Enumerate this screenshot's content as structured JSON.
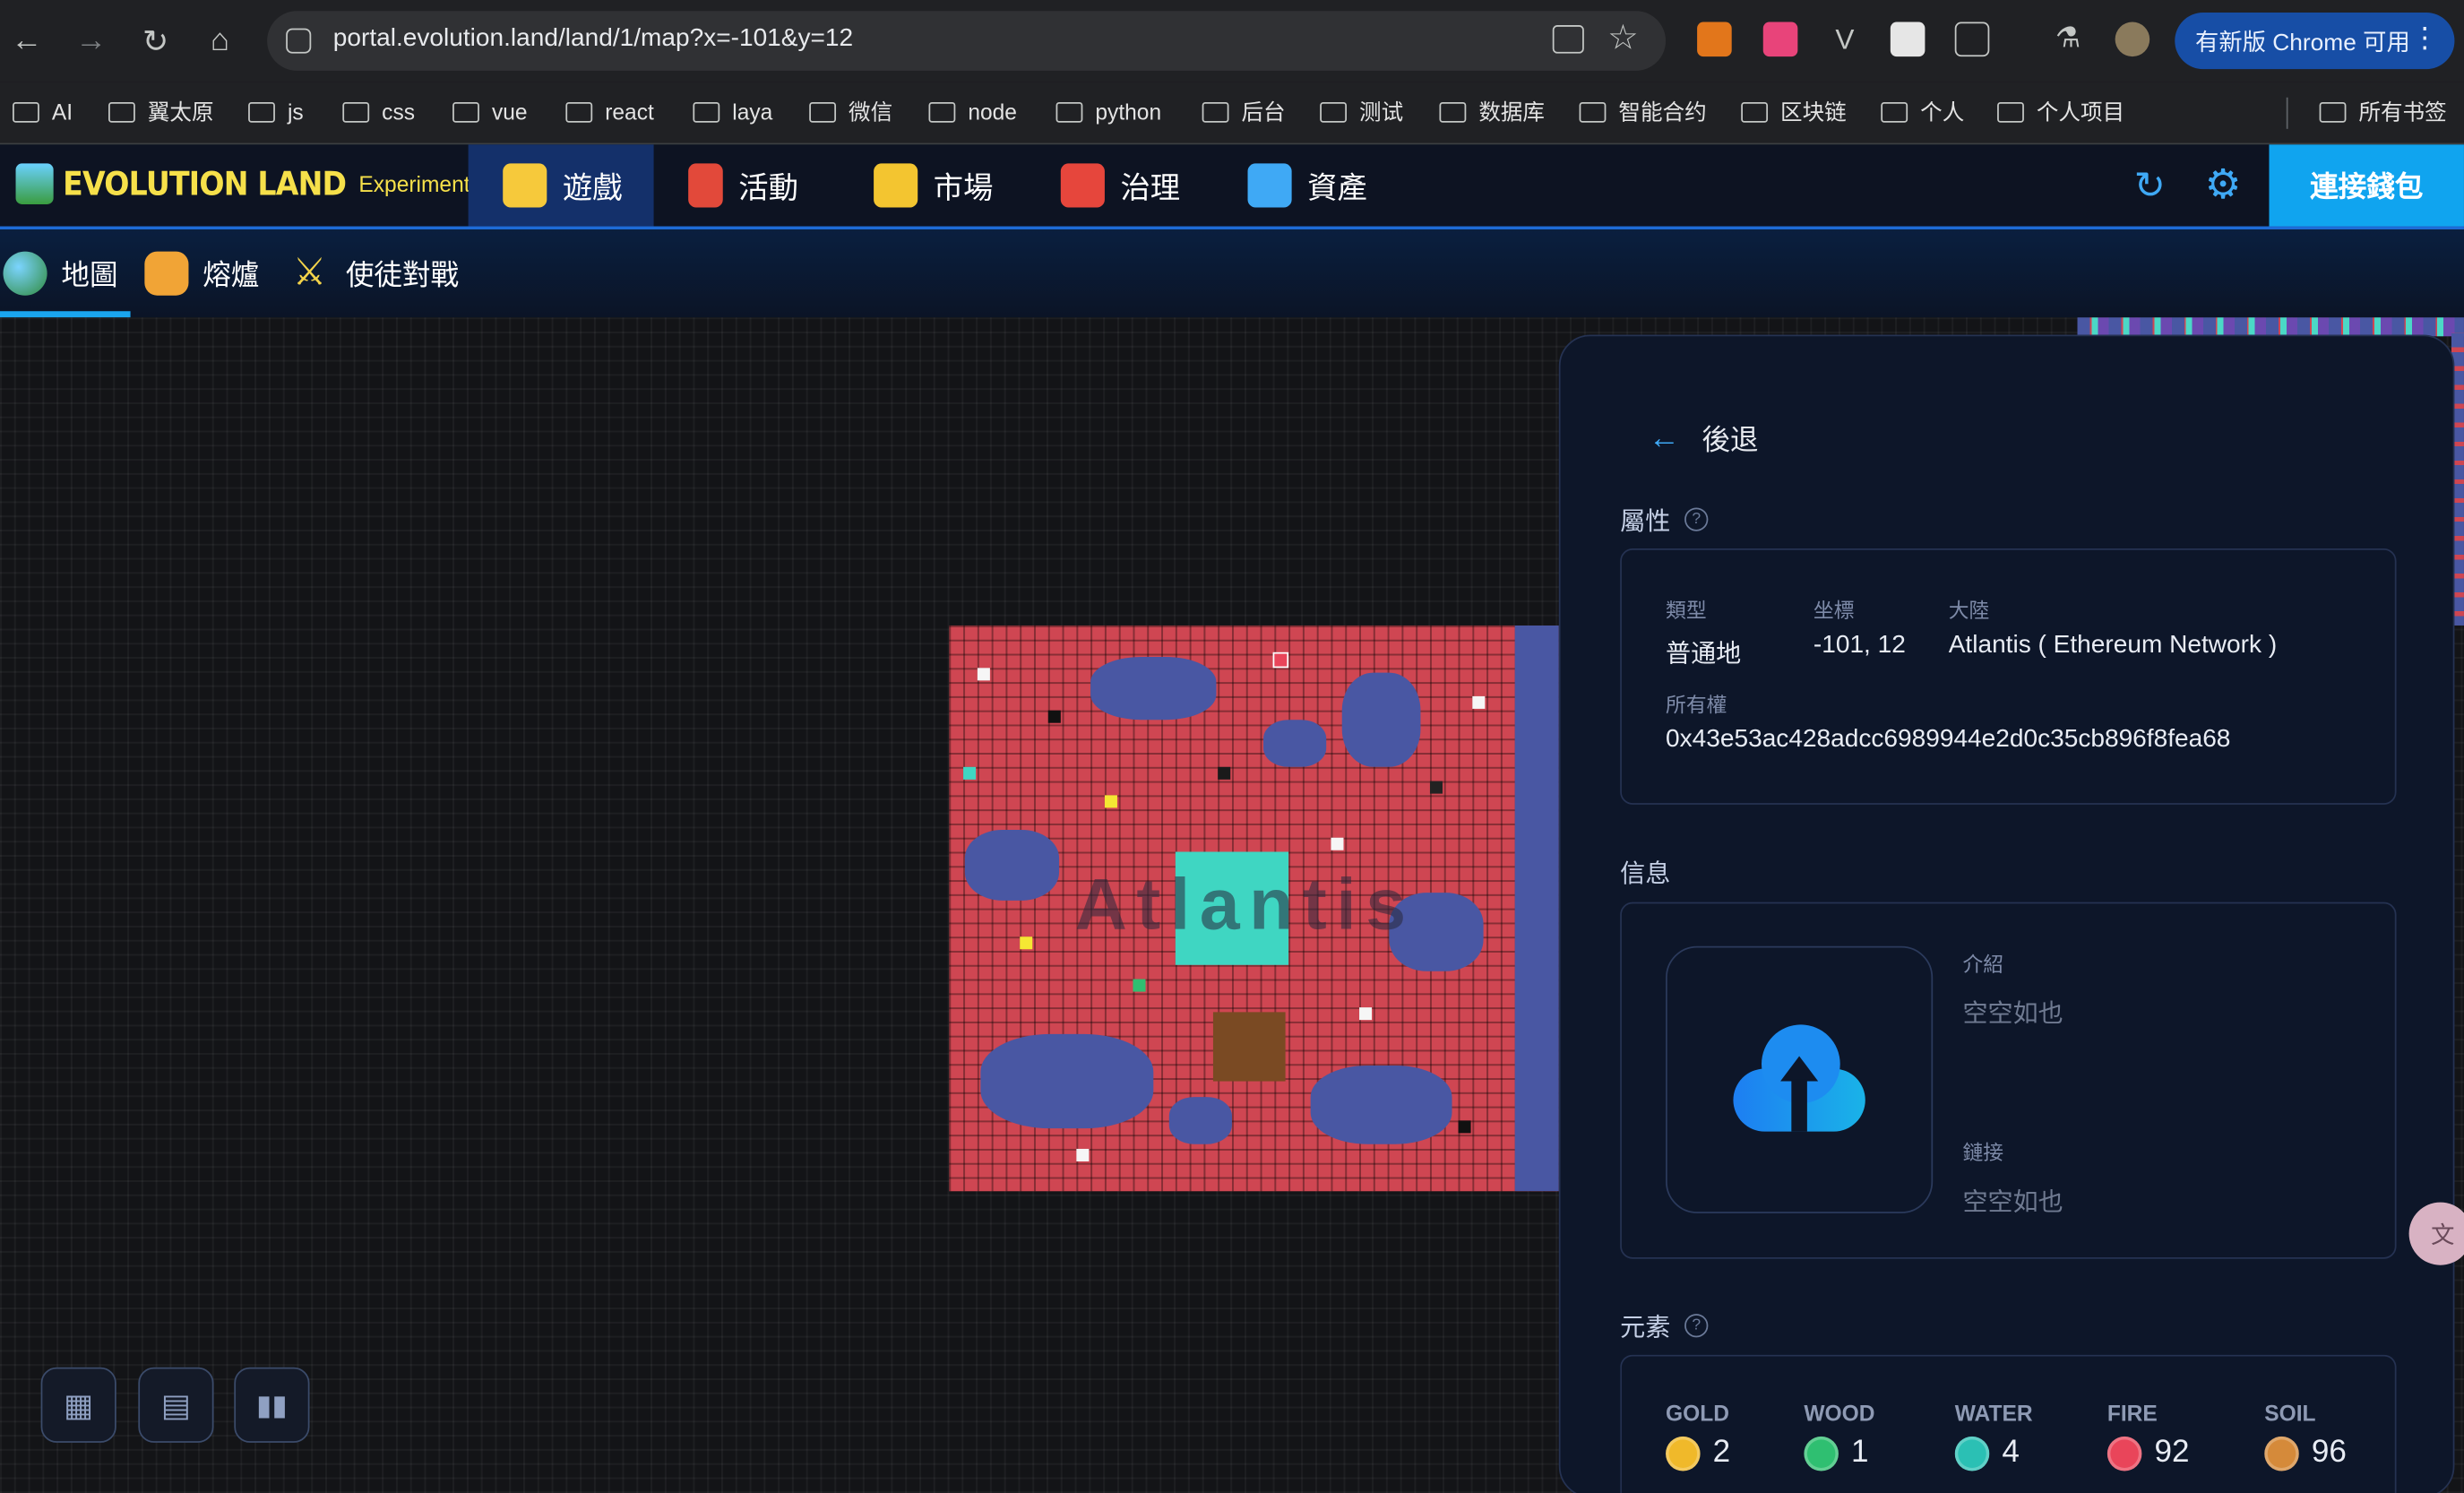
{
  "browser": {
    "url": "portal.evolution.land/land/1/map?x=-101&y=12",
    "update_label": "有新版 Chrome 可用",
    "bookmarks": [
      "AI",
      "翼太原",
      "js",
      "css",
      "vue",
      "react",
      "laya",
      "微信",
      "node",
      "python",
      "后台",
      "测试",
      "数据库",
      "智能合约",
      "区块链",
      "个人",
      "个人项目"
    ],
    "all_bookmarks": "所有书签"
  },
  "app": {
    "logo_title": "EVOLUTION LAND",
    "logo_sub": "Experimental",
    "nav": [
      "遊戲",
      "活動",
      "市場",
      "治理",
      "資產"
    ],
    "connect_label": "連接錢包",
    "subnav": [
      "地圖",
      "熔爐",
      "使徒對戰"
    ]
  },
  "map": {
    "land_label": "Atlantis"
  },
  "panel": {
    "back_label": "後退",
    "attributes_title": "屬性",
    "type_label": "類型",
    "type_value": "普通地",
    "coord_label": "坐標",
    "coord_value": "-101, 12",
    "continent_label": "大陸",
    "continent_value": "Atlantis ( Ethereum Network )",
    "owner_label": "所有權",
    "owner_value": "0x43e53ac428adcc6989944e2d0c35cb896f8fea68",
    "info_title": "信息",
    "intro_label": "介紹",
    "intro_value": "空空如也",
    "link_label": "鏈接",
    "link_value": "空空如也",
    "elements_title": "元素",
    "elements": [
      {
        "name": "GOLD",
        "value": "2",
        "color": "#f0b92a"
      },
      {
        "name": "WOOD",
        "value": "1",
        "color": "#2fbf71"
      },
      {
        "name": "WATER",
        "value": "4",
        "color": "#2bc0b4"
      },
      {
        "name": "FIRE",
        "value": "92",
        "color": "#e9455a"
      },
      {
        "name": "SOIL",
        "value": "96",
        "color": "#d58a3a"
      }
    ]
  }
}
